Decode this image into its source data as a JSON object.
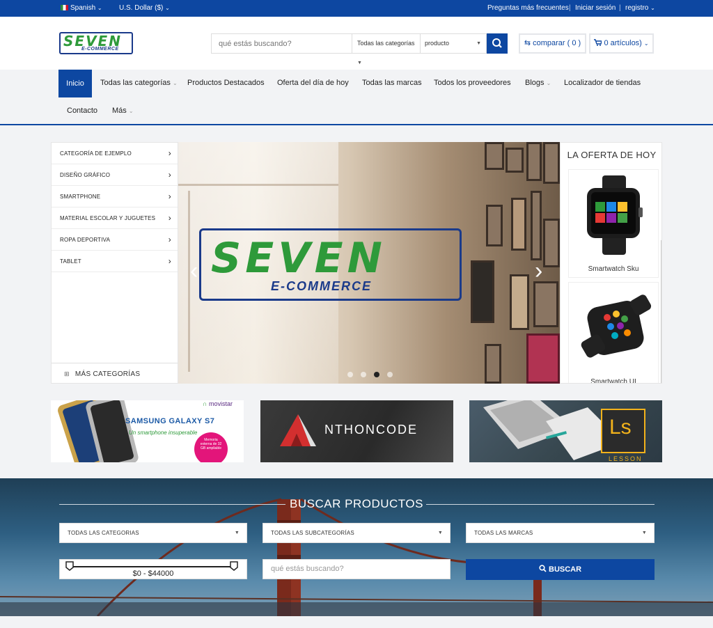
{
  "topbar": {
    "language": "Spanish",
    "currency": "U.S. Dollar ($)",
    "faq": "Preguntas más frecuentes",
    "login": "Iniciar sesión",
    "register": "registro"
  },
  "header": {
    "logo_main": "SEVEN",
    "logo_sub": "E-COMMERCE",
    "search_placeholder": "qué estás buscando?",
    "search_category": "Todas las categorías",
    "search_type": "producto",
    "compare_label": "comparar ( 0 )",
    "cart_label": "0 artículos)"
  },
  "nav": {
    "items": [
      {
        "label": "Inicio",
        "active": true
      },
      {
        "label": "Todas las categorías",
        "dropdown": true
      },
      {
        "label": "Productos Destacados"
      },
      {
        "label": "Oferta del día de hoy"
      },
      {
        "label": "Todas las marcas"
      },
      {
        "label": "Todos los proveedores"
      },
      {
        "label": "Blogs",
        "dropdown": true
      },
      {
        "label": "Localizador de tiendas"
      },
      {
        "label": "Contacto"
      },
      {
        "label": "Más",
        "dropdown": true
      }
    ]
  },
  "sidebar": {
    "items": [
      {
        "label": "CATEGORÍA DE EJEMPLO"
      },
      {
        "label": "DISEÑO GRÁFICO"
      },
      {
        "label": "SMARTPHONE"
      },
      {
        "label": "MATERIAL ESCOLAR Y JUGUETES"
      },
      {
        "label": "ROPA DEPORTIVA"
      },
      {
        "label": "TABLET"
      }
    ],
    "more_label": "MÁS CATEGORÍAS"
  },
  "slider": {
    "logo_main": "SEVEN",
    "logo_sub": "E-COMMERCE",
    "active_dot": 3,
    "dot_count": 4
  },
  "deal": {
    "title": "LA OFERTA DE HOY",
    "products": [
      {
        "name": "Smartwatch Sku"
      },
      {
        "name": "Smartwatch UI"
      }
    ]
  },
  "banners": {
    "samsung_brand": "movistar",
    "samsung_title": "SAMSUNG GALAXY S7",
    "samsung_tagline": "Un smartphone insuperable",
    "samsung_badge": "Memoria externa de 32 GB ampliable",
    "anthon_letter": "A",
    "anthon_text": "NTHONCODE",
    "lesson_mark": "Ls",
    "lesson_text": "LESSON"
  },
  "find": {
    "title": "BUSCAR PRODUCTOS",
    "categories": "TODAS LAS CATEGORIAS",
    "subcategories": "TODAS LAS SUBCATEGORÍAS",
    "brands": "TODAS LAS MARCAS",
    "price_range": "$0 - $44000",
    "search_placeholder": "qué estás buscando?",
    "search_button": "BUSCAR"
  },
  "colors": {
    "primary": "#0d47a1",
    "logo_green": "#2e9a3a",
    "logo_navy": "#1a3a8a"
  }
}
